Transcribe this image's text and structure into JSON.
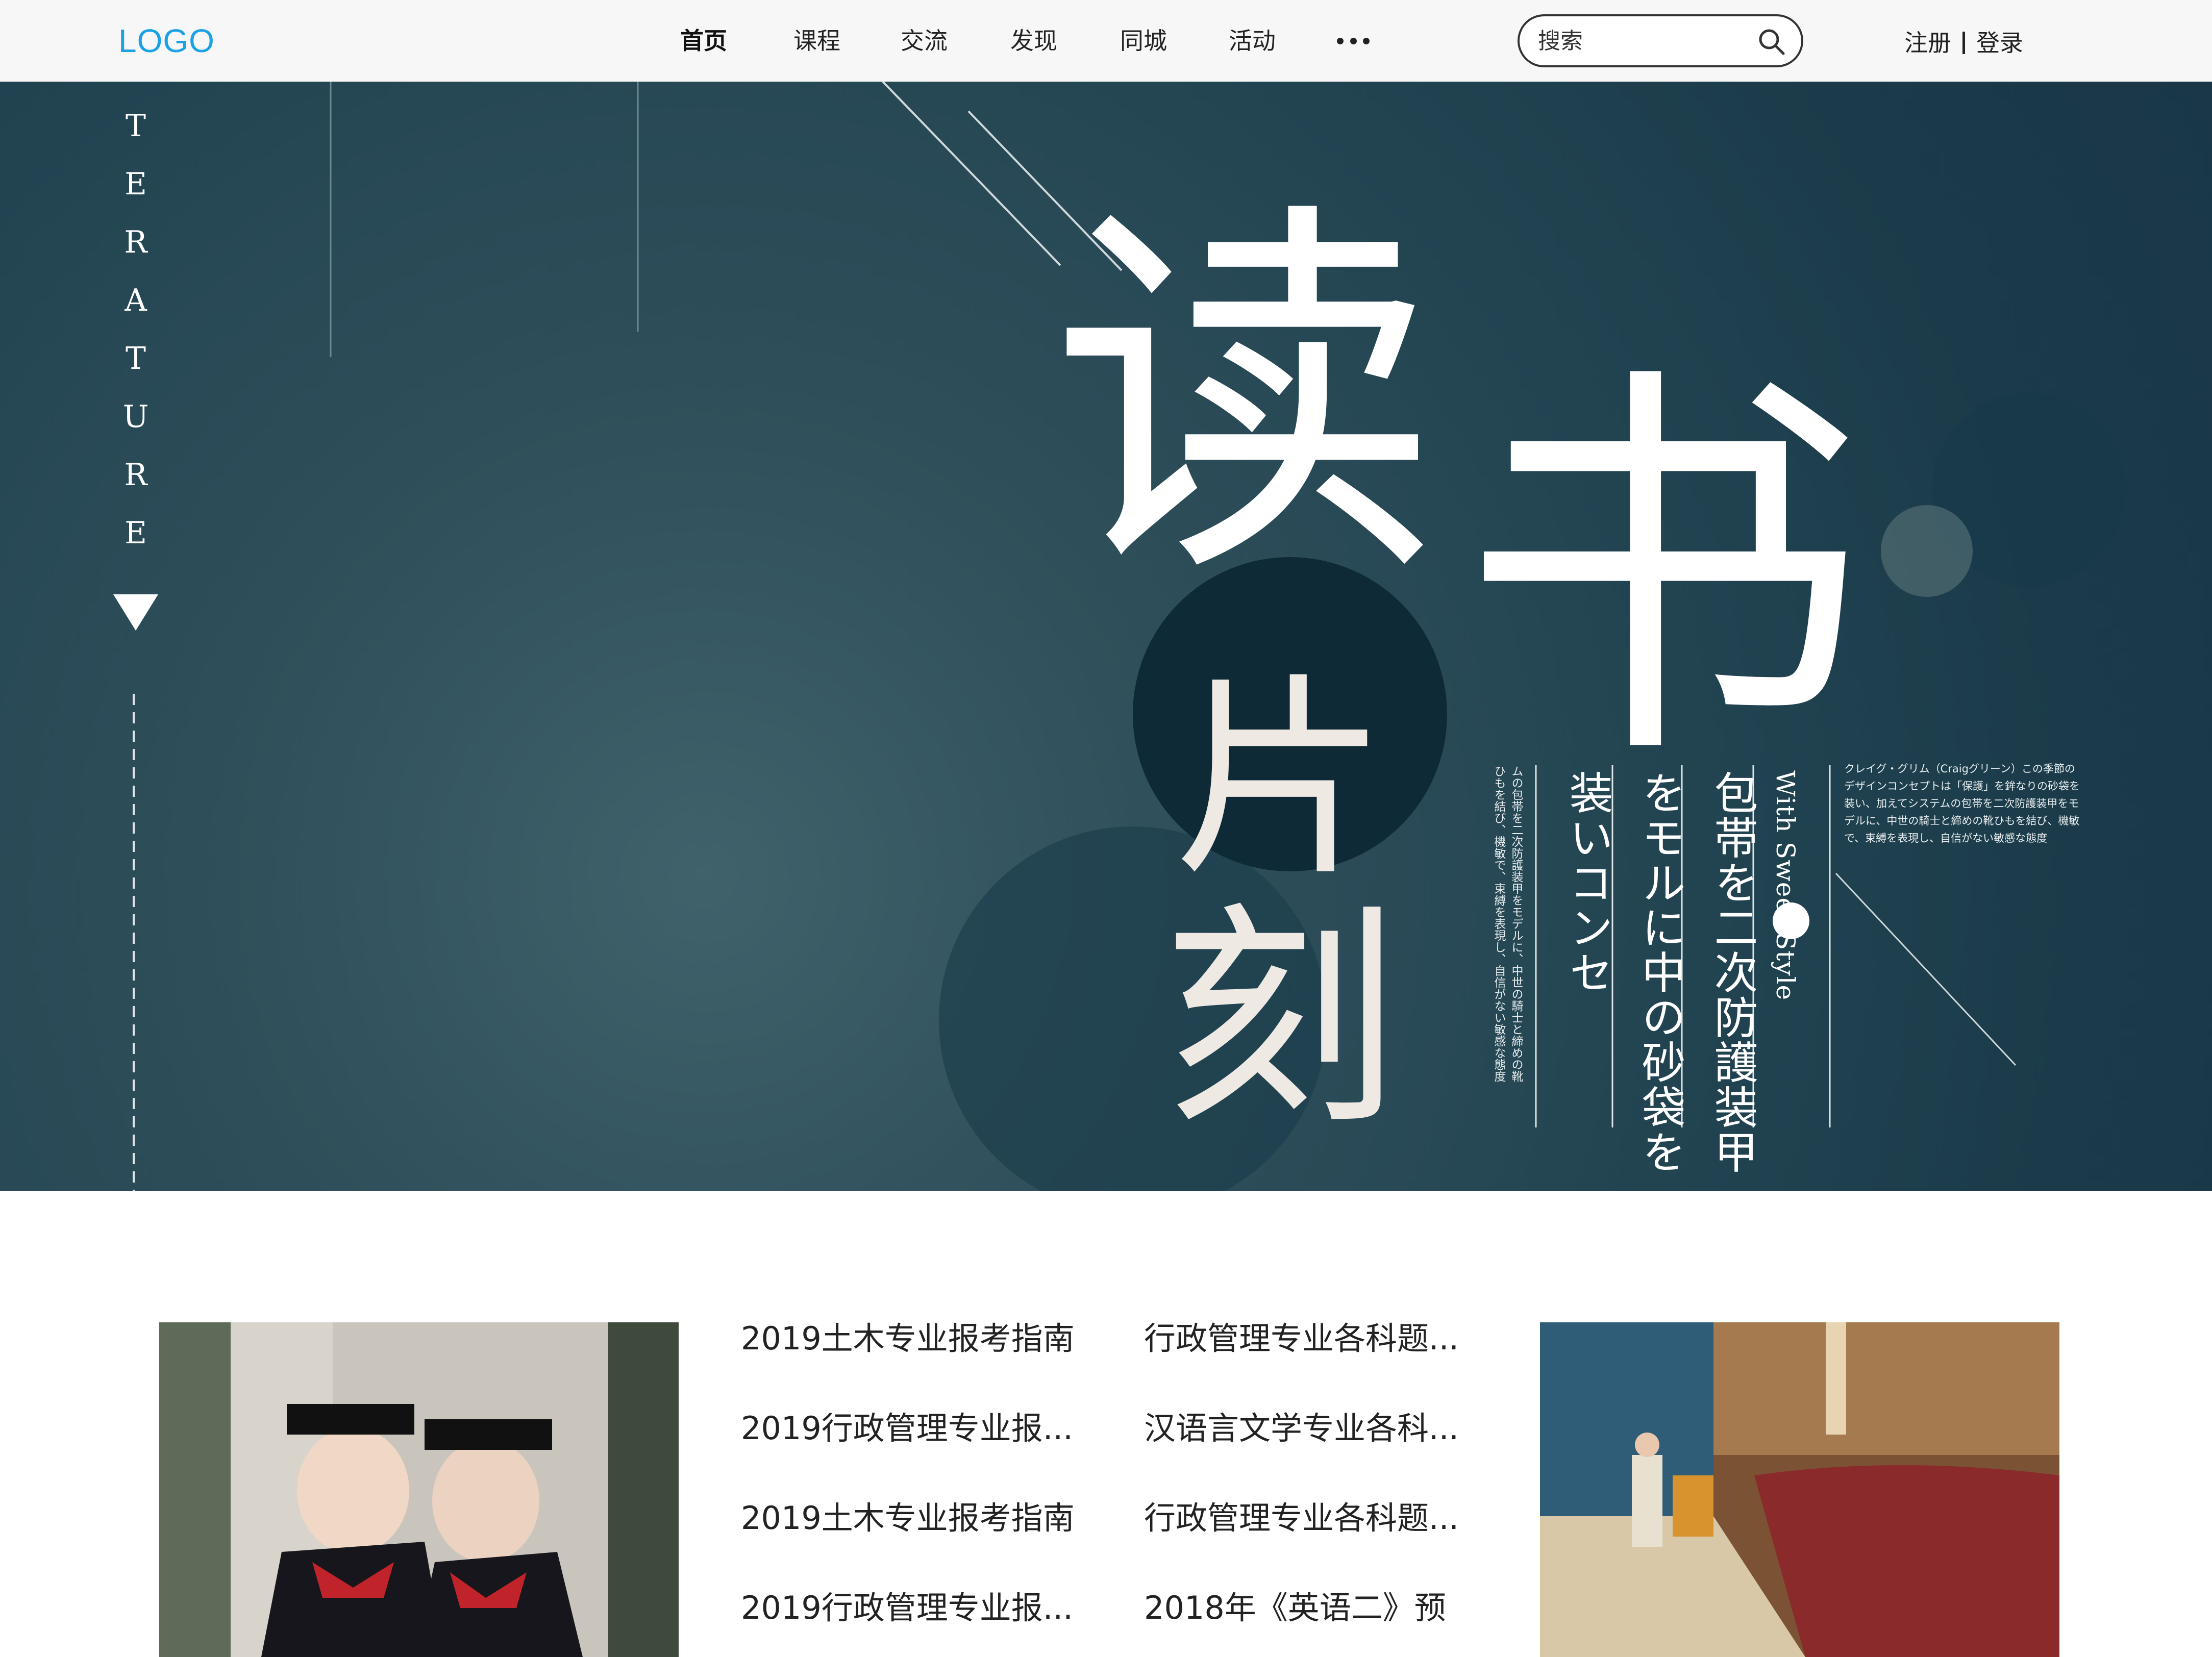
{
  "header": {
    "logo": "LOGO",
    "nav": [
      {
        "label": "首页",
        "active": true
      },
      {
        "label": "课程",
        "active": false
      },
      {
        "label": "交流",
        "active": false
      },
      {
        "label": "发现",
        "active": false
      },
      {
        "label": "同城",
        "active": false
      },
      {
        "label": "活动",
        "active": false
      }
    ],
    "more_icon": "ellipsis-icon",
    "search": {
      "placeholder": "搜索",
      "icon": "search-icon"
    },
    "auth": {
      "register": "注册",
      "login": "登录"
    }
  },
  "banner": {
    "side_text": "TERATURE",
    "headline": [
      "读",
      "书",
      "片",
      "刻"
    ],
    "vertical_lines": [
      "包帯を二次防護装甲",
      "をモルに中の砂袋を",
      "装いコンセ"
    ],
    "sweet_style": "With Sweet Style",
    "side_paragraph": "クレイグ・グリム（Craigグリーン）この季節のデザインコンセプトは「保護」を鉾なりの砂袋を装い、加えてシステムの包帯を二次防護装甲をモデルに、中世の騎士と締めの靴ひもを結び、機敏で、束縛を表現し、自信がない敏感な態度",
    "vertical_small": "ムの包帯を二次防護装甲をモデルに、中世の騎士と締めの靴ひもを結び、機敏で、束縛を表現し、自信がない敏感な態度",
    "colors": {
      "background": "#1f3f4d",
      "accent": "#ffffff"
    }
  },
  "news": {
    "column1": [
      "2019土木专业报考指南",
      "2019行政管理专业报...",
      "2019土木专业报考指南",
      "2019行政管理专业报..."
    ],
    "column2": [
      "行政管理专业各科题...",
      "汉语言文学专业各科...",
      "行政管理专业各科题...",
      "2018年《英语二》预"
    ]
  }
}
